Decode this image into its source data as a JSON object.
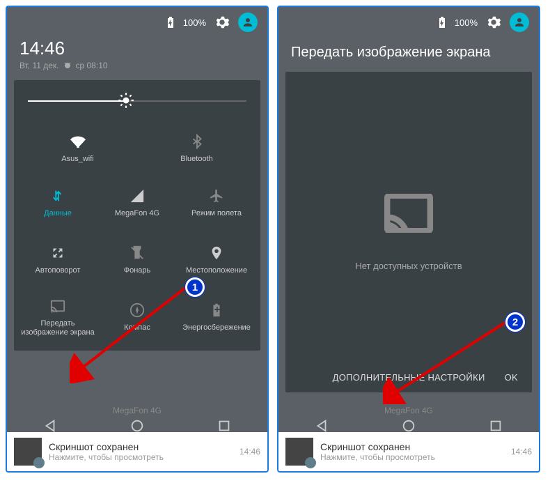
{
  "status": {
    "battery": "100%"
  },
  "left": {
    "time": "14:46",
    "date": "Вт, 11 дек.",
    "alarm": "ср 08:10",
    "brightness": 45,
    "tiles": {
      "wifi": "Asus_wifi",
      "bt": "Bluetooth",
      "data": "Данные",
      "cell": "MegaFon 4G",
      "airplane": "Режим полета",
      "rotate": "Автоповорот",
      "flash": "Фонарь",
      "location": "Местоположение",
      "cast": "Передать изображение экрана",
      "compass": "Компас",
      "battery": "Энергосбережение"
    },
    "carrier": "MegaFon 4G"
  },
  "right": {
    "title": "Передать изображение экрана",
    "empty": "Нет доступных устройств",
    "more": "ДОПОЛНИТЕЛЬНЫЕ НАСТРОЙКИ",
    "ok": "OK"
  },
  "notif": {
    "title": "Скриншот сохранен",
    "sub": "Нажмите, чтобы просмотреть",
    "time": "14:46"
  },
  "markers": {
    "m1": "1",
    "m2": "2"
  }
}
